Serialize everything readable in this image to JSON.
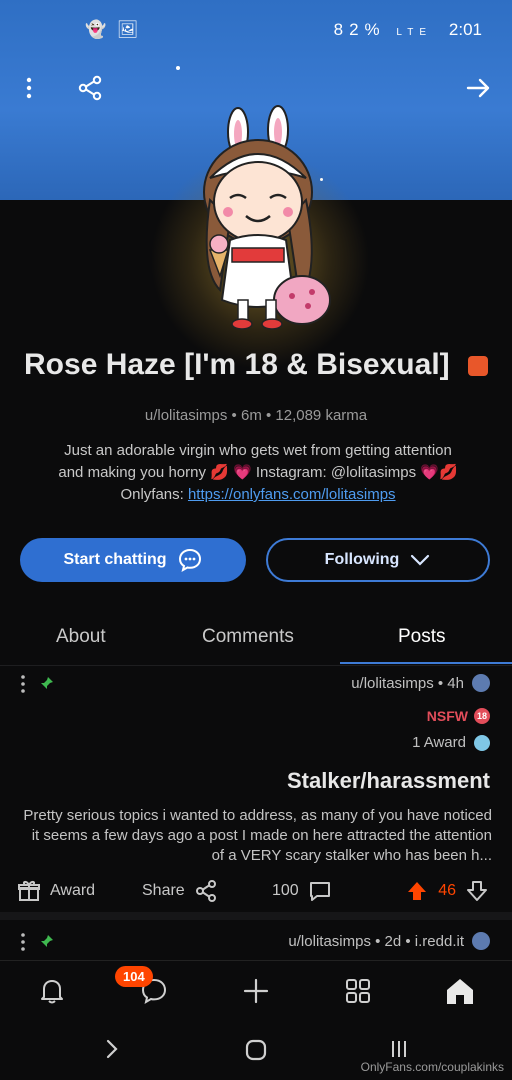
{
  "status_bar": {
    "time": "2:01",
    "battery": "82%",
    "network": "LTE"
  },
  "profile": {
    "title": "Rose Haze [I'm 18 & Bisexual]",
    "meta": "u/lolitasimps • 6m • 12,089 karma",
    "bio_line1": "Just an adorable virgin who gets wet from getting attention",
    "bio_line2": "and making you horny 💋 💗 Instagram: @lolitasimps 💗💋",
    "bio_line3_prefix": "Onlyfans: ",
    "bio_link": "https://onlyfans.com/lolitasimps"
  },
  "buttons": {
    "following": "Following",
    "start_chatting": "Start chatting"
  },
  "tabs": {
    "posts": "Posts",
    "comments": "Comments",
    "about": "About"
  },
  "post1": {
    "meta": "u/lolitasimps • 4h",
    "nsfw": "NSFW",
    "nsfw_badge": "18",
    "awards": "1 Award",
    "title": "Stalker/harassment",
    "body": "Pretty serious topics i wanted to address, as many of you have noticed it seems a few days ago a post I made on here attracted the attention of a VERY scary stalker who has been h...",
    "upvotes": "46",
    "comments": "100",
    "share": "Share",
    "award": "Award"
  },
  "post2": {
    "meta": "u/lolitasimps • 2d • i.redd.it"
  },
  "nav": {
    "chat_badge": "104"
  },
  "system_bar": {
    "url": "OnlyFans.com/couplakinks"
  },
  "colors": {
    "accent": "#3e7bd6",
    "upvote": "#ff4500",
    "nsfw": "#e24d5a",
    "banner": "#3a7bd2"
  }
}
